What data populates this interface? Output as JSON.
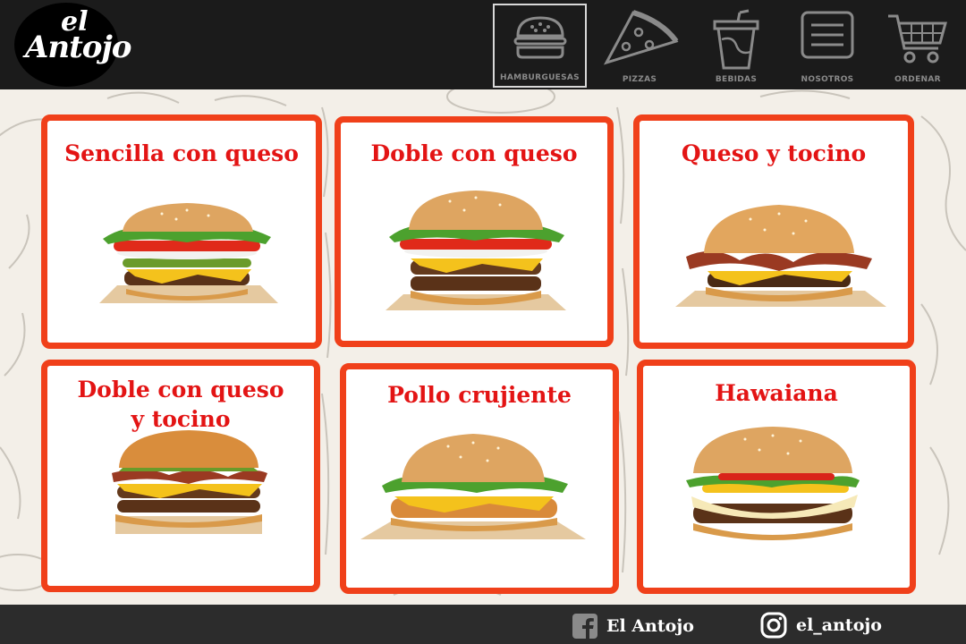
{
  "brand": {
    "logo_small": "el",
    "logo_main": "Antojo"
  },
  "nav": {
    "items": [
      {
        "label": "HAMBURGUESAS",
        "icon": "burger-icon",
        "active": true
      },
      {
        "label": "PIZZAS",
        "icon": "pizza-icon",
        "active": false
      },
      {
        "label": "BEBIDAS",
        "icon": "drink-icon",
        "active": false
      },
      {
        "label": "NOSOTROS",
        "icon": "menu-icon",
        "active": false
      },
      {
        "label": "ORDENAR",
        "icon": "cart-icon",
        "active": false
      }
    ]
  },
  "menu": {
    "items": [
      {
        "title": "Sencilla con queso"
      },
      {
        "title": "Doble con queso"
      },
      {
        "title": "Queso y tocino"
      },
      {
        "title_line1": "Doble con queso",
        "title_line2": "y tocino"
      },
      {
        "title": "Pollo crujiente"
      },
      {
        "title": "Hawaiana"
      }
    ]
  },
  "footer": {
    "facebook": {
      "label": "El Antojo",
      "icon": "facebook-icon"
    },
    "instagram": {
      "label": "el_antojo",
      "icon": "instagram-icon"
    }
  },
  "colors": {
    "accent": "#f0401a",
    "title_red": "#e31414",
    "header_bg": "#1b1b1b",
    "footer_bg": "#2c2c2c"
  }
}
